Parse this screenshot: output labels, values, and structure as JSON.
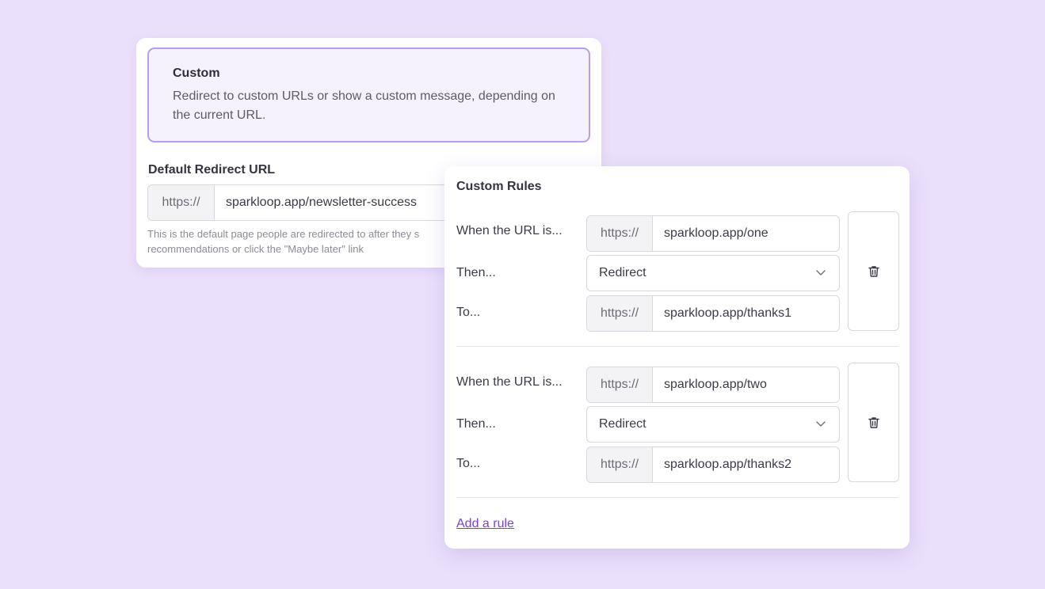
{
  "custom_option": {
    "title": "Custom",
    "description": "Redirect to custom URLs or show a custom message, depending on the current URL."
  },
  "default_redirect": {
    "label": "Default Redirect URL",
    "prefix": "https://",
    "value": "sparkloop.app/newsletter-success",
    "help_line1": "This is the default page people are redirected to after they s",
    "help_line2": "recommendations or click the \"Maybe later\" link"
  },
  "custom_rules": {
    "title": "Custom Rules",
    "rules": [
      {
        "when_label": "When the URL is...",
        "when_prefix": "https://",
        "when_value": "sparkloop.app/one",
        "then_label": "Then...",
        "action": "Redirect",
        "to_label": "To...",
        "to_prefix": "https://",
        "to_value": "sparkloop.app/thanks1"
      },
      {
        "when_label": "When the URL is...",
        "when_prefix": "https://",
        "when_value": "sparkloop.app/two",
        "then_label": "Then...",
        "action": "Redirect",
        "to_label": "To...",
        "to_prefix": "https://",
        "to_value": "sparkloop.app/thanks2"
      }
    ],
    "add_rule_label": "Add a rule"
  },
  "colors": {
    "background": "#ebe0fb",
    "accent": "#7b3fe4",
    "option_border": "#b79cf0"
  },
  "icons": {
    "delete": "trash-icon",
    "select": "chevron-down-icon"
  }
}
